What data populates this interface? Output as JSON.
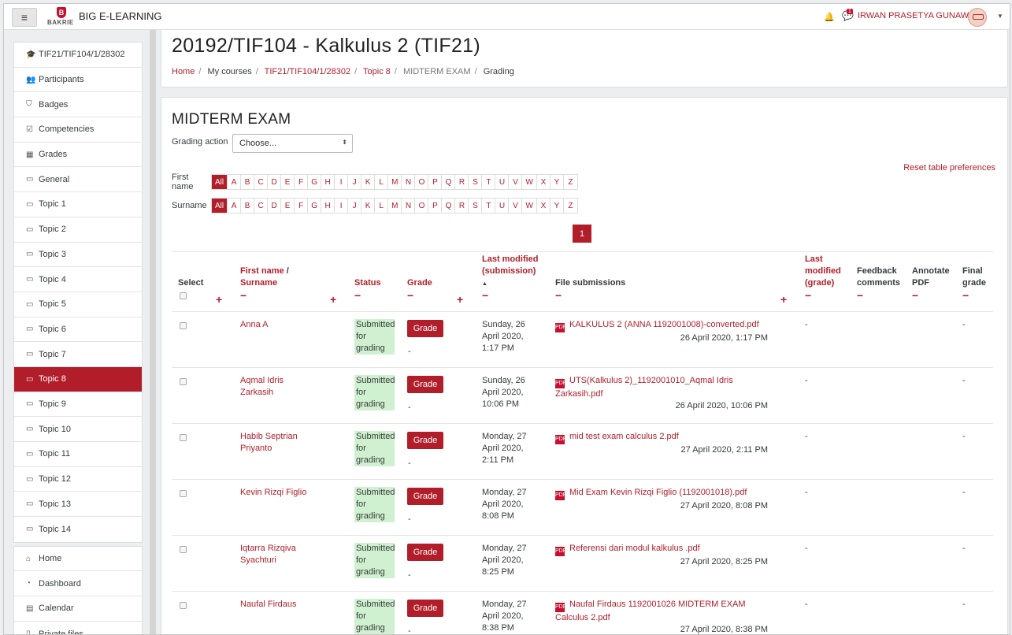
{
  "topbar": {
    "site_name": "BIG E-LEARNING",
    "logo_text": "BAKRIE",
    "logo_mark": "B",
    "user_name": "IRWAN PRASETYA GUNAWAN",
    "msg_count": "1"
  },
  "sidebar": {
    "course_items": [
      {
        "icon": "graduation-cap-icon",
        "glyph": "🎓",
        "label": "TIF21/TIF104/1/28302"
      },
      {
        "icon": "users-icon",
        "glyph": "👥",
        "label": "Participants"
      },
      {
        "icon": "shield-icon",
        "glyph": "⛉",
        "label": "Badges"
      },
      {
        "icon": "check-square-icon",
        "glyph": "☑",
        "label": "Competencies"
      },
      {
        "icon": "table-icon",
        "glyph": "▦",
        "label": "Grades"
      },
      {
        "icon": "folder-icon",
        "glyph": "▭",
        "label": "General"
      },
      {
        "icon": "folder-icon",
        "glyph": "▭",
        "label": "Topic 1"
      },
      {
        "icon": "folder-icon",
        "glyph": "▭",
        "label": "Topic 2"
      },
      {
        "icon": "folder-icon",
        "glyph": "▭",
        "label": "Topic 3"
      },
      {
        "icon": "folder-icon",
        "glyph": "▭",
        "label": "Topic 4"
      },
      {
        "icon": "folder-icon",
        "glyph": "▭",
        "label": "Topic 5"
      },
      {
        "icon": "folder-icon",
        "glyph": "▭",
        "label": "Topic 6"
      },
      {
        "icon": "folder-icon",
        "glyph": "▭",
        "label": "Topic 7"
      },
      {
        "icon": "folder-icon",
        "glyph": "▭",
        "label": "Topic 8"
      },
      {
        "icon": "folder-icon",
        "glyph": "▭",
        "label": "Topic 9"
      },
      {
        "icon": "folder-icon",
        "glyph": "▭",
        "label": "Topic 10"
      },
      {
        "icon": "folder-icon",
        "glyph": "▭",
        "label": "Topic 11"
      },
      {
        "icon": "folder-icon",
        "glyph": "▭",
        "label": "Topic 12"
      },
      {
        "icon": "folder-icon",
        "glyph": "▭",
        "label": "Topic 13"
      },
      {
        "icon": "folder-icon",
        "glyph": "▭",
        "label": "Topic 14"
      }
    ],
    "active_label": "Topic 8",
    "site_items": [
      {
        "icon": "home-icon",
        "glyph": "⌂",
        "label": "Home"
      },
      {
        "icon": "dashboard-icon",
        "glyph": "◔",
        "label": "Dashboard"
      },
      {
        "icon": "calendar-icon",
        "glyph": "▤",
        "label": "Calendar"
      },
      {
        "icon": "file-icon",
        "glyph": "▯",
        "label": "Private files"
      }
    ]
  },
  "header": {
    "course_title": "20192/TIF104 - Kalkulus 2 (TIF21)",
    "breadcrumb": [
      "Home",
      "My courses",
      "TIF21/TIF104/1/28302",
      "Topic 8",
      "MIDTERM EXAM",
      "Grading"
    ]
  },
  "main": {
    "heading": "MIDTERM EXAM",
    "grading_action_label": "Grading action",
    "grading_action_value": "Choose...",
    "reset_link": "Reset table preferences",
    "first_name_label": "First name",
    "surname_label": "Surname",
    "letters": [
      "All",
      "A",
      "B",
      "C",
      "D",
      "E",
      "F",
      "G",
      "H",
      "I",
      "J",
      "K",
      "L",
      "M",
      "N",
      "O",
      "P",
      "Q",
      "R",
      "S",
      "T",
      "U",
      "V",
      "W",
      "X",
      "Y",
      "Z"
    ],
    "current_page": "1",
    "columns": {
      "select": "Select",
      "name": "First name",
      "name_sep": "/",
      "surname": "Surname",
      "status": "Status",
      "grade": "Grade",
      "last_modified_sub": "Last modified (submission)",
      "file_submissions": "File submissions",
      "last_modified_grade": "Last modified (grade)",
      "feedback": "Feedback comments",
      "annotate": "Annotate PDF",
      "final_grade": "Final grade"
    },
    "grade_button": "Grade",
    "rows": [
      {
        "name": "Anna A",
        "status": "Submitted for grading",
        "modified": "Sunday, 26 April 2020, 1:17 PM",
        "file": "KALKULUS 2 (ANNA 1192001008)-converted.pdf",
        "file_date": "26 April 2020, 1:17 PM",
        "grade_mod": "-",
        "final": "-",
        "gdash": "-"
      },
      {
        "name": "Aqmal Idris Zarkasih",
        "status": "Submitted for grading",
        "modified": "Sunday, 26 April 2020, 10:06 PM",
        "file": "UTS(Kalkulus 2)_1192001010_Aqmal Idris Zarkasih.pdf",
        "file_date": "26 April 2020, 10:06 PM",
        "grade_mod": "-",
        "final": "-",
        "gdash": "-"
      },
      {
        "name": "Habib Septrian Priyanto",
        "status": "Submitted for grading",
        "modified": "Monday, 27 April 2020, 2:11 PM",
        "file": "mid test exam calculus 2.pdf",
        "file_date": "27 April 2020, 2:11 PM",
        "grade_mod": "-",
        "final": "-",
        "gdash": "-"
      },
      {
        "name": "Kevin Rizqi Figlio",
        "status": "Submitted for grading",
        "modified": "Monday, 27 April 2020, 8:08 PM",
        "file": "Mid Exam Kevin Rizqi Figlio (1192001018).pdf",
        "file_date": "27 April 2020, 8:08 PM",
        "grade_mod": "-",
        "final": "-",
        "gdash": "-"
      },
      {
        "name": "Iqtarra Rizqiva Syachturi",
        "status": "Submitted for grading",
        "modified": "Monday, 27 April 2020, 8:25 PM",
        "file": "Referensi dari modul kalkulus .pdf",
        "file_date": "27 April 2020, 8:25 PM",
        "grade_mod": "-",
        "final": "-",
        "gdash": "-"
      },
      {
        "name": "Naufal Firdaus",
        "status": "Submitted for grading",
        "modified": "Monday, 27 April 2020, 8:38 PM",
        "file": "Naufal Firdaus 1192001026 MIDTERM EXAM Calculus 2.pdf",
        "file_date": "27 April 2020, 8:38 PM",
        "grade_mod": "-",
        "final": "-",
        "gdash": "-"
      }
    ]
  },
  "colors": {
    "accent": "#b11e2a",
    "status_bg": "#cff1cf"
  },
  "icons": {
    "menu": "hamburger-icon",
    "bell": "bell-icon",
    "message": "message-icon",
    "sort": "sort-up-icon",
    "pdf": "pdf-file-icon"
  }
}
